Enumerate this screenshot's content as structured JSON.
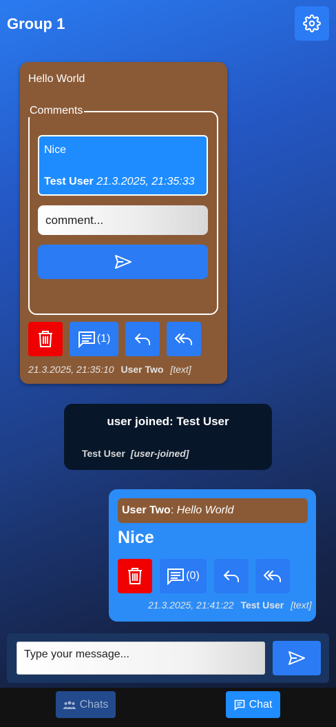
{
  "header": {
    "title": "Group 1",
    "settings_icon": "gear-icon"
  },
  "messages": [
    {
      "text": "Hello World",
      "comments_legend": "Comments",
      "comments": [
        {
          "text": "Nice",
          "user": "Test User",
          "timestamp": "21.3.2025, 21:35:33"
        }
      ],
      "comment_placeholder": "comment...",
      "comment_count": "(1)",
      "timestamp": "21.3.2025, 21:35:10",
      "user": "User Two",
      "type": "[text]",
      "bg_color": "#8a5a36"
    },
    {
      "system_text": "user joined: Test User",
      "user": "Test User",
      "type": "[user-joined]"
    },
    {
      "reply_user": "User Two",
      "reply_sep": ": ",
      "reply_text": "Hello World",
      "text": "Nice",
      "comment_count": "(0)",
      "timestamp": "21.3.2025, 21:41:22",
      "user": "Test User",
      "type": "[text]"
    }
  ],
  "composer": {
    "placeholder": "Type your message..."
  },
  "nav": {
    "chats_label": "Chats",
    "chat_label": "Chat"
  },
  "colors": {
    "accent": "#2b7bf5",
    "delete": "#f00000",
    "message_brown": "#8a5a36",
    "system_bg": "#071629"
  }
}
